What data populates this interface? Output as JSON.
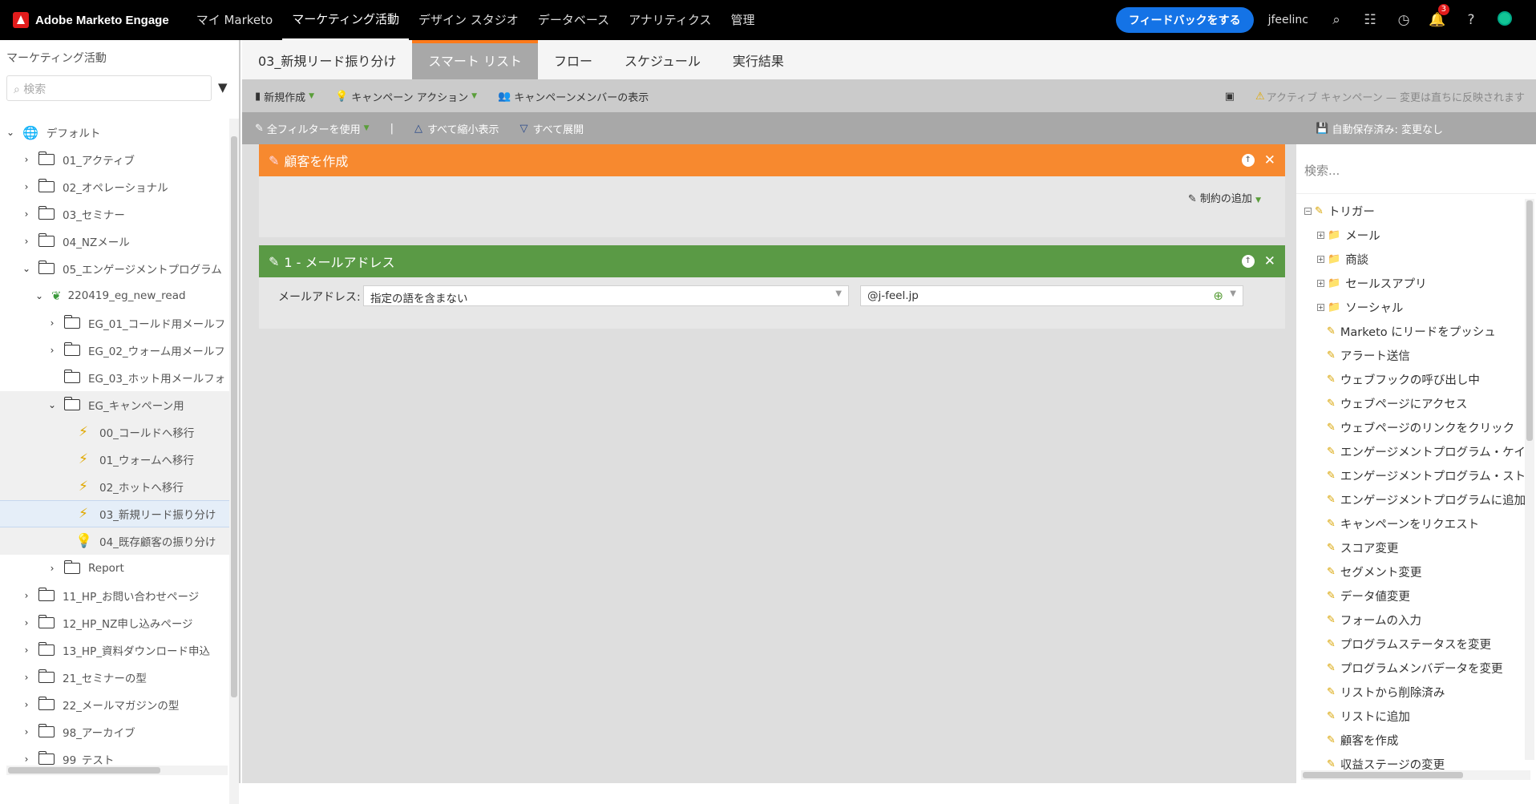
{
  "app": {
    "name": "Adobe Marketo Engage"
  },
  "nav": {
    "items": [
      "マイ Marketo",
      "マーケティング活動",
      "デザイン スタジオ",
      "データベース",
      "アナリティクス",
      "管理"
    ]
  },
  "top": {
    "feedback": "フィードバックをする",
    "user": "jfeelinc",
    "notification_count": "3"
  },
  "sidebar": {
    "title": "マーケティング活動",
    "search_placeholder": "検索",
    "tree": [
      {
        "label": "デフォルト"
      },
      {
        "label": "01_アクティブ"
      },
      {
        "label": "02_オペレーショナル"
      },
      {
        "label": "03_セミナー"
      },
      {
        "label": "04_NZメール"
      },
      {
        "label": "05_エンゲージメントプログラム"
      },
      {
        "label": "220419_eg_new_read"
      },
      {
        "label": "EG_01_コールド用メールフ"
      },
      {
        "label": "EG_02_ウォーム用メールフ"
      },
      {
        "label": "EG_03_ホット用メールフォ"
      },
      {
        "label": "EG_キャンペーン用"
      },
      {
        "label": "00_コールドへ移行"
      },
      {
        "label": "01_ウォームへ移行"
      },
      {
        "label": "02_ホットへ移行"
      },
      {
        "label": "03_新規リード振り分け"
      },
      {
        "label": "04_既存顧客の振り分け"
      },
      {
        "label": "Report"
      },
      {
        "label": "11_HP_お問い合わせページ"
      },
      {
        "label": "12_HP_NZ申し込みページ"
      },
      {
        "label": "13_HP_資料ダウンロード申込"
      },
      {
        "label": "21_セミナーの型"
      },
      {
        "label": "22_メールマガジンの型"
      },
      {
        "label": "98_アーカイブ"
      },
      {
        "label": "99_テスト"
      }
    ]
  },
  "tabs": [
    "03_新規リード振り分け",
    "スマート リスト",
    "フロー",
    "スケジュール",
    "実行結果"
  ],
  "toolbar": {
    "new": "新規作成",
    "campaign_action": "キャンペーン アクション",
    "show_members": "キャンペーンメンバーの表示",
    "active_notice": "アクティブ キャンペーン — 変更は直ちに反映されます"
  },
  "toolbar2": {
    "use_all_filters": "全フィルターを使用",
    "separator": "|",
    "collapse_all": "すべて縮小表示",
    "expand_all": "すべて展開",
    "autosave": "自動保存済み: 変更なし"
  },
  "trigger_card": {
    "title": "顧客を作成",
    "add_constraint": "制約の追加",
    "color": "#f7892f"
  },
  "filter_card": {
    "title": "1 - メールアドレス",
    "field_label": "メールアドレス:",
    "operator": "指定の語を含まない",
    "value": "@j-feel.jp",
    "color": "#5a9a45"
  },
  "right_panel": {
    "search_placeholder": "検索...",
    "tree": [
      "トリガー",
      "メール",
      "商談",
      "セールスアプリ",
      "ソーシャル",
      "Marketo にリードをプッシュ",
      "アラート送信",
      "ウェブフックの呼び出し中",
      "ウェブページにアクセス",
      "ウェブページのリンクをクリック",
      "エンゲージメントプログラム・ケイ",
      "エンゲージメントプログラム・スト",
      "エンゲージメントプログラムに追加",
      "キャンペーンをリクエスト",
      "スコア変更",
      "セグメント変更",
      "データ値変更",
      "フォームの入力",
      "プログラムステータスを変更",
      "プログラムメンバデータを変更",
      "リストから削除済み",
      "リストに追加",
      "顧客を作成",
      "収益ステージの変更"
    ]
  }
}
